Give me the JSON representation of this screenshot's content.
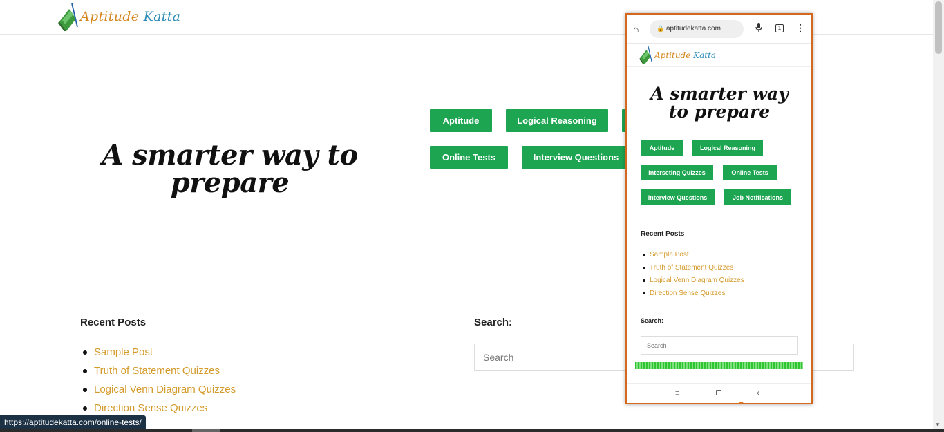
{
  "site": {
    "logo_part1": "Aptitude",
    "logo_part2": "Katta"
  },
  "hero": {
    "title": "A smarter way to prepare"
  },
  "nav_buttons": {
    "aptitude": "Aptitude",
    "logical_reasoning": "Logical Reasoning",
    "online_tests": "Online Tests",
    "interview_questions": "Interview Questions"
  },
  "recent_posts": {
    "title": "Recent Posts",
    "items": [
      "Sample Post",
      "Truth of Statement Quizzes",
      "Logical Venn Diagram Quizzes",
      "Direction Sense Quizzes"
    ]
  },
  "search": {
    "label": "Search:",
    "placeholder": "Search"
  },
  "status_bar": {
    "url": "https://aptitudekatta.com/online-tests/"
  },
  "phone": {
    "url": "aptitudekatta.com",
    "tab_count": "1",
    "logo_part1": "Aptitude",
    "logo_part2": "Katta",
    "hero_title": "A smarter way to prepare",
    "buttons": {
      "aptitude": "Aptitude",
      "logical_reasoning": "Logical Reasoning",
      "interesting_quizzes": "Interseting Quizzes",
      "online_tests": "Online Tests",
      "interview_questions": "Interview Questions",
      "job_notifications": "Job Notifications"
    },
    "recent_posts": {
      "title": "Recent Posts",
      "items": [
        "Sample Post",
        "Truth of Statement Quizzes",
        "Logical Venn Diagram Quizzes",
        "Direction Sense Quizzes"
      ]
    },
    "search": {
      "label": "Search:",
      "placeholder": "Search"
    }
  },
  "colors": {
    "button_green": "#1da552",
    "link_gold": "#d49a2a",
    "phone_border": "#d2691e"
  },
  "icons": [
    "book-logo-icon",
    "home-icon",
    "lock-icon",
    "mic-icon",
    "tabs-icon",
    "more-vert-icon",
    "recents-icon",
    "home-square-icon",
    "back-icon"
  ]
}
